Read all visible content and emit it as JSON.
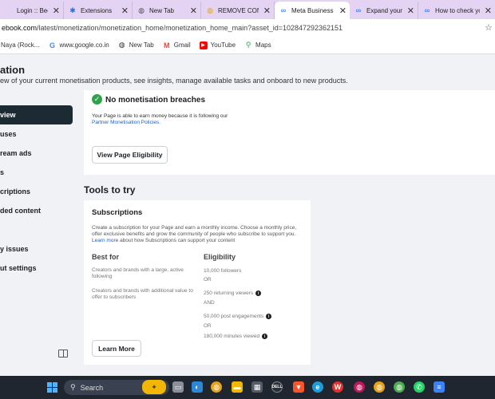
{
  "browser": {
    "tabs": [
      {
        "label": "Login :: Beehive",
        "icon": "beehive-icon",
        "active": false
      },
      {
        "label": "Extensions",
        "icon": "puzzle-icon",
        "active": false
      },
      {
        "label": "New Tab",
        "icon": "chrome-icon",
        "active": false
      },
      {
        "label": "REMOVE CONTE",
        "icon": "chrome-icon",
        "active": false
      },
      {
        "label": "Meta Business S",
        "icon": "meta-icon",
        "active": true
      },
      {
        "label": "Expand your op",
        "icon": "meta-icon",
        "active": false
      },
      {
        "label": "How to check yo",
        "icon": "meta-icon",
        "active": false
      }
    ],
    "address": {
      "host": "ebook.com",
      "path": "/latest/monetization/monetization_home/monetization_home_main?asset_id=102847292362151"
    },
    "bookmarks": [
      {
        "label": "Naya (Rock...",
        "icon": ""
      },
      {
        "label": "www.google.co.in",
        "icon": "google-icon"
      },
      {
        "label": "New Tab",
        "icon": "chrome-icon"
      },
      {
        "label": "Gmail",
        "icon": "gmail-icon"
      },
      {
        "label": "YouTube",
        "icon": "youtube-icon"
      },
      {
        "label": "Maps",
        "icon": "maps-icon"
      }
    ]
  },
  "page": {
    "title": "ation",
    "subtitle": "ew of your current monetisation products, see insights, manage available tasks and onboard to new products."
  },
  "sidebar": {
    "items": [
      {
        "label": "view",
        "active": true
      },
      {
        "label": "uses",
        "active": false
      },
      {
        "label": "ream ads",
        "active": false
      },
      {
        "label": "s",
        "active": false
      },
      {
        "label": "criptions",
        "active": false
      },
      {
        "label": "ded content",
        "active": false
      },
      {
        "label": "",
        "active": false
      },
      {
        "label": "y issues",
        "active": false
      },
      {
        "label": "ut settings",
        "active": false
      }
    ]
  },
  "breaches": {
    "title": "No monetisation breaches",
    "text": "Your Page is able to earn money because it is following our",
    "link": "Partner Monetisation Policies.",
    "button": "View Page Eligibility"
  },
  "tools": {
    "heading": "Tools to try",
    "subscriptions": {
      "title": "Subscriptions",
      "desc": "Create a subscription for your Page and earn a monthly income. Choose a monthly price, offer exclusive benefits and grow the community of people who subscribe to support you.",
      "desc_link": "Learn more",
      "desc_tail": "about how Subscriptions can support your content",
      "best_for_heading": "Best for",
      "best_for": [
        "Creators and brands with a large, active following",
        "Creators and brands with additional value to offer to subscribers"
      ],
      "eligibility_heading": "Eligibility",
      "eligibility": [
        {
          "text": "10,000 followers",
          "info": false
        },
        {
          "text": "OR",
          "info": false
        },
        {
          "text": "250 returning viewers",
          "info": true
        },
        {
          "text": "AND",
          "info": false
        },
        {
          "text": "50,000 post engagements",
          "info": true
        },
        {
          "text": "OR",
          "info": false
        },
        {
          "text": "180,000 minutes viewed",
          "info": true
        }
      ],
      "button": "Learn More"
    }
  },
  "taskbar": {
    "search_label": "Search"
  },
  "colors": {
    "tabstrip": "#e4d3f3",
    "sidebar_active": "#1c2b33",
    "check_green": "#31a24c",
    "link_blue": "#1a60c2",
    "taskbar": "#1f2630"
  }
}
